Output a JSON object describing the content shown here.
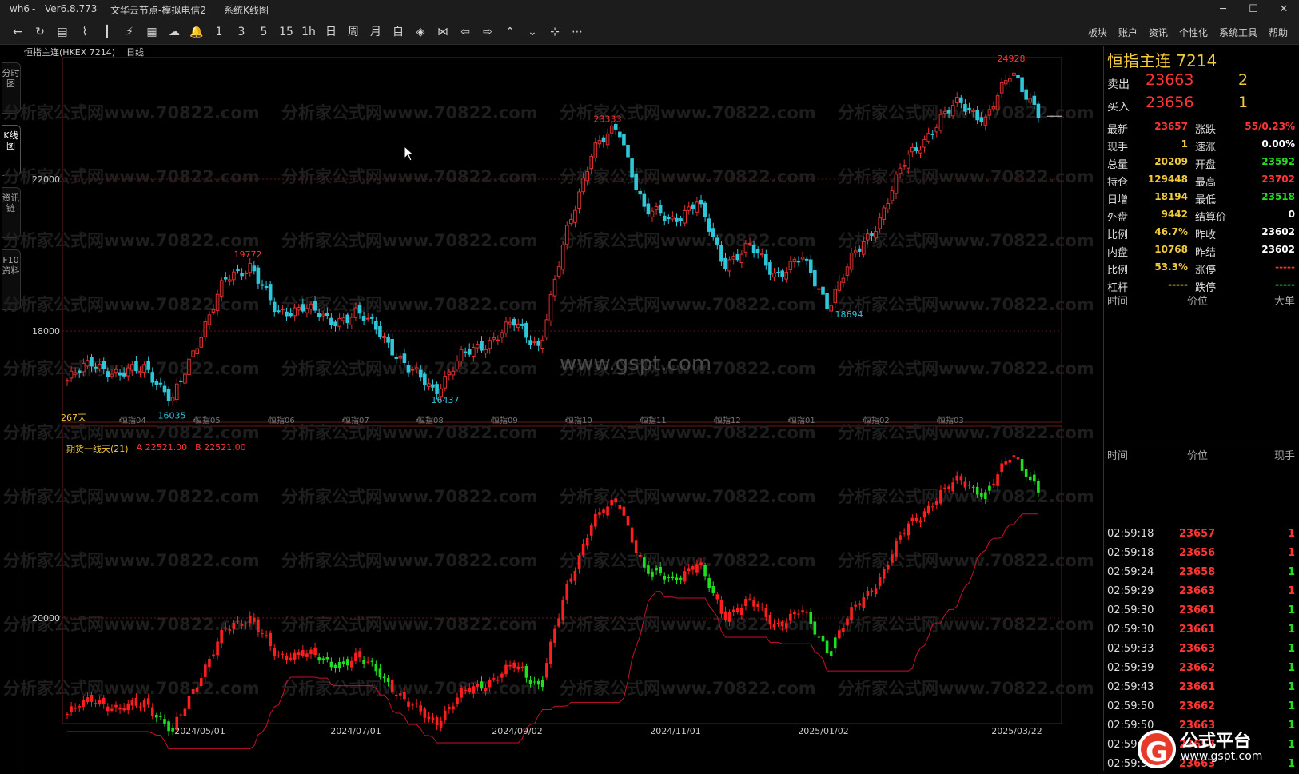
{
  "title_bar": {
    "app": "wh6",
    "version": "Ver6.8.773",
    "node": "文华云节点-模拟电信2",
    "view": "系统K线图",
    "controls": [
      "─",
      "☐",
      "✕"
    ]
  },
  "toolbar": {
    "icons": [
      {
        "name": "back-icon",
        "g": "←"
      },
      {
        "name": "refresh-icon",
        "g": "↻"
      },
      {
        "name": "list-icon",
        "g": "▤"
      },
      {
        "name": "line-chart-icon",
        "g": "⌇"
      },
      {
        "name": "candle-icon",
        "g": "┃"
      },
      {
        "name": "indicator-icon",
        "g": "⚡"
      },
      {
        "name": "layout-icon",
        "g": "▦"
      },
      {
        "name": "cloud-icon",
        "g": "☁"
      },
      {
        "name": "alarm-icon",
        "g": "🔔"
      },
      {
        "name": "period-1",
        "g": "1"
      },
      {
        "name": "period-3",
        "g": "3"
      },
      {
        "name": "period-5",
        "g": "5"
      },
      {
        "name": "period-15",
        "g": "15"
      },
      {
        "name": "period-1h",
        "g": "1h"
      },
      {
        "name": "period-day",
        "g": "日"
      },
      {
        "name": "period-week",
        "g": "周"
      },
      {
        "name": "period-month",
        "g": "月"
      },
      {
        "name": "period-custom",
        "g": "自"
      },
      {
        "name": "zoom-icon",
        "g": "◈"
      },
      {
        "name": "compare-icon",
        "g": "⋈"
      },
      {
        "name": "left-icon",
        "g": "⇦"
      },
      {
        "name": "right-icon",
        "g": "⇨"
      },
      {
        "name": "up-icon",
        "g": "⌃"
      },
      {
        "name": "down-icon",
        "g": "⌄"
      },
      {
        "name": "crosshair-icon",
        "g": "⊹"
      },
      {
        "name": "more-icon",
        "g": "⋯"
      }
    ],
    "menus": [
      "板块",
      "账户",
      "资讯",
      "个性化",
      "系统工具",
      "帮助"
    ]
  },
  "left_tabs": [
    "分时图",
    "K线图",
    "资讯链",
    "F10资料"
  ],
  "chart_header": {
    "symbol": "恒指主连(HKEX 7214)",
    "period": "日线"
  },
  "indicator_header": {
    "name": "期货一线天(21)",
    "a": "A 22521.00",
    "b": "B 22521.00"
  },
  "watermark": "分析家公式网www.70822.com",
  "center_watermark": "www.gspt.com",
  "chart_data": {
    "type": "candlestick",
    "x_tick_labels_top": [
      "恒指04",
      "恒指05",
      "恒指06",
      "恒指07",
      "恒指08",
      "恒指09",
      "恒指10",
      "恒指11",
      "恒指12",
      "恒指01",
      "恒指02",
      "恒指03"
    ],
    "x_tick_labels_bottom": [
      "2024/05/01",
      "2024/07/01",
      "2024/09/02",
      "2024/11/01",
      "2025/01/02",
      "2025/03/22"
    ],
    "y_ticks_upper": [
      18000,
      22000
    ],
    "y_ticks_lower": [
      20000
    ],
    "annotations": [
      {
        "label": "24928",
        "kind": "high"
      },
      {
        "label": "23333",
        "kind": "high"
      },
      {
        "label": "19772",
        "kind": "high"
      },
      {
        "label": "16437",
        "kind": "low"
      },
      {
        "label": "18694",
        "kind": "low"
      },
      {
        "label": "16035",
        "kind": "low"
      }
    ],
    "corner_label": "267天",
    "key_closes": [
      16700,
      17200,
      16800,
      17100,
      16100,
      17800,
      19300,
      19772,
      18400,
      18700,
      18200,
      18500,
      17900,
      17000,
      16437,
      17300,
      17700,
      18200,
      17600,
      20500,
      22800,
      23333,
      21200,
      20900,
      21400,
      19800,
      20200,
      19500,
      19900,
      18694,
      20000,
      21000,
      22600,
      23300,
      24100,
      23500,
      24928,
      23657
    ],
    "colors": {
      "up": "#e03030",
      "down": "#2ec6d8",
      "ind_up": "#ff1e1e",
      "ind_down": "#1ee01e",
      "ind_line": "#c8102e"
    }
  },
  "quote": {
    "name": "恒指主连",
    "code": "7214",
    "ask": {
      "label": "卖出",
      "price": "23663",
      "vol": "2"
    },
    "bid": {
      "label": "买入",
      "price": "23656",
      "vol": "1"
    },
    "grid": [
      {
        "k1": "最新",
        "v1": "23657",
        "c1": "#ff3535",
        "k2": "涨跌",
        "v2": "55/0.23%",
        "c2": "#ff3535"
      },
      {
        "k1": "现手",
        "v1": "1",
        "c1": "#f2cb3a",
        "k2": "速涨",
        "v2": "0.00%",
        "c2": "#ffffff"
      },
      {
        "k1": "总量",
        "v1": "20209",
        "c1": "#f2cb3a",
        "k2": "开盘",
        "v2": "23592",
        "c2": "#22dd22"
      },
      {
        "k1": "持仓",
        "v1": "129448",
        "c1": "#f2cb3a",
        "k2": "最高",
        "v2": "23702",
        "c2": "#ff3535"
      },
      {
        "k1": "日增",
        "v1": "18194",
        "c1": "#f2cb3a",
        "k2": "最低",
        "v2": "23518",
        "c2": "#22dd22"
      },
      {
        "k1": "外盘",
        "v1": "9442",
        "c1": "#f2cb3a",
        "k2": "结算价",
        "v2": "0",
        "c2": "#ffffff"
      },
      {
        "k1": "比例",
        "v1": "46.7%",
        "c1": "#f2cb3a",
        "k2": "昨收",
        "v2": "23602",
        "c2": "#ffffff"
      },
      {
        "k1": "内盘",
        "v1": "10768",
        "c1": "#f2cb3a",
        "k2": "昨结",
        "v2": "23602",
        "c2": "#ffffff"
      },
      {
        "k1": "比例",
        "v1": "53.3%",
        "c1": "#f2cb3a",
        "k2": "涨停",
        "v2": "-----",
        "c2": "#ff3535"
      },
      {
        "k1": "杠杆",
        "v1": "-----",
        "c1": "#f2cb3a",
        "k2": "跌停",
        "v2": "-----",
        "c2": "#22dd22"
      }
    ],
    "big_header": [
      "时间",
      "价位",
      "大单"
    ],
    "tick_header": [
      "时间",
      "价位",
      "现手"
    ],
    "ticks": [
      {
        "t": "02:59:18",
        "p": "23657",
        "v": "1",
        "vc": "#ff3535"
      },
      {
        "t": "02:59:18",
        "p": "23656",
        "v": "1",
        "vc": "#ff3535"
      },
      {
        "t": "02:59:24",
        "p": "23658",
        "v": "1",
        "vc": "#22dd22"
      },
      {
        "t": "02:59:29",
        "p": "23663",
        "v": "1",
        "vc": "#ff3535"
      },
      {
        "t": "02:59:30",
        "p": "23661",
        "v": "1",
        "vc": "#22dd22"
      },
      {
        "t": "02:59:30",
        "p": "23661",
        "v": "1",
        "vc": "#22dd22"
      },
      {
        "t": "02:59:33",
        "p": "23663",
        "v": "1",
        "vc": "#22dd22"
      },
      {
        "t": "02:59:39",
        "p": "23662",
        "v": "1",
        "vc": "#22dd22"
      },
      {
        "t": "02:59:43",
        "p": "23661",
        "v": "1",
        "vc": "#22dd22"
      },
      {
        "t": "02:59:50",
        "p": "23662",
        "v": "1",
        "vc": "#22dd22"
      },
      {
        "t": "02:59:50",
        "p": "23663",
        "v": "1",
        "vc": "#22dd22"
      },
      {
        "t": "02:59:55",
        "p": "23657",
        "v": "1",
        "vc": "#22dd22"
      },
      {
        "t": "02:59:55",
        "p": "23663",
        "v": "1",
        "vc": "#22dd22"
      }
    ]
  },
  "logo": {
    "mark": "G",
    "name": "公式平台",
    "url": "www.gspt.com"
  }
}
